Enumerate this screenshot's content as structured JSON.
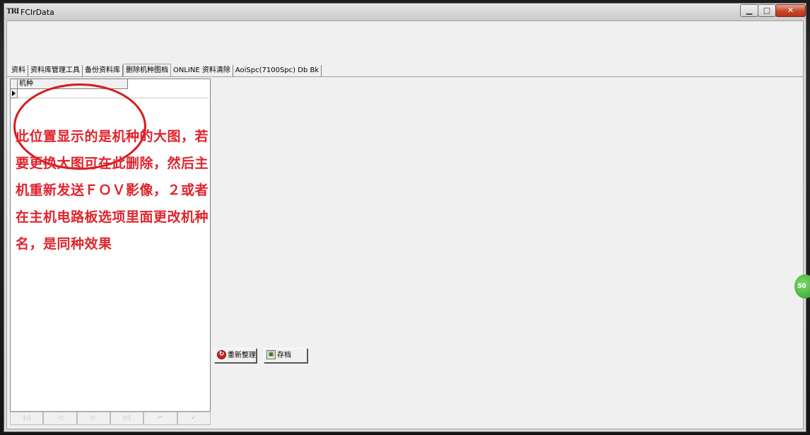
{
  "window": {
    "title": "FClrData",
    "icon_text": "TRI",
    "controls": {
      "minimize": "▁",
      "maximize": "□",
      "close": "✕"
    }
  },
  "tabs": [
    {
      "label": "资料",
      "active": false
    },
    {
      "label": "资料库管理工具",
      "active": false
    },
    {
      "label": "备份资料库",
      "active": false
    },
    {
      "label": "删除机种图档",
      "active": true
    },
    {
      "label": "ONLINE 资料清除",
      "active": false
    },
    {
      "label": "AoiSpc(7100Spc) Db Bk",
      "active": false
    }
  ],
  "grid": {
    "column_header": "机种",
    "rows": [
      ""
    ]
  },
  "annotation": {
    "lines": [
      "此位置显示的是机种的大图，若",
      "要更换大图可在此删除，然后主",
      "机重新发送ＦＯＶ影像，２或者",
      "在主机电路板选项里面更改机种",
      "名，是同种效果"
    ],
    "color": "#e0242c"
  },
  "navigator": {
    "buttons": [
      "first",
      "prior",
      "next",
      "last",
      "post",
      "refresh"
    ],
    "glyphs": [
      "|◁",
      "◁",
      "▷",
      "▷|",
      "⌐",
      "✓"
    ]
  },
  "actions": {
    "reorganize_label": "重新整理",
    "save_label": "存档"
  },
  "side_widget": {
    "text": "50"
  }
}
